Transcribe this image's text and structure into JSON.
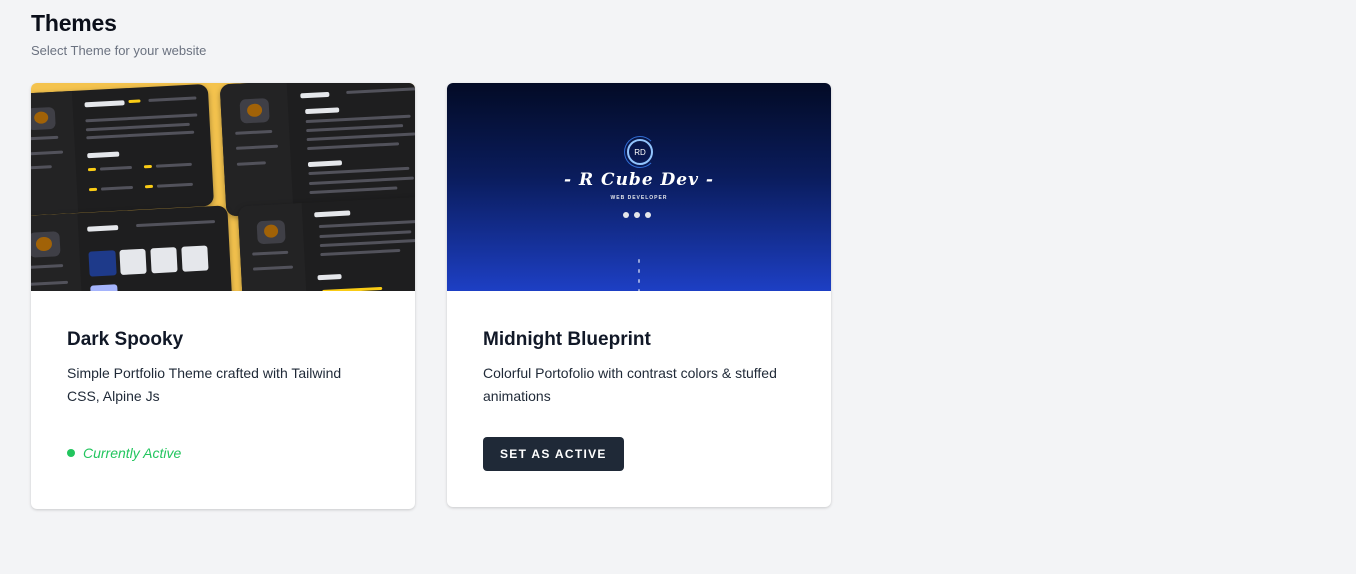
{
  "page": {
    "title": "Themes",
    "subtitle": "Select Theme for your website"
  },
  "themes": [
    {
      "name": "Dark Spooky",
      "description": "Simple Portfolio Theme crafted with Tailwind CSS, Alpine Js",
      "status": "Currently Active",
      "status_color": "#22c55e",
      "active": true
    },
    {
      "name": "Midnight Blueprint",
      "description": "Colorful Portofolio with contrast colors & stuffed animations",
      "action_label": "Set as active",
      "active": false
    }
  ],
  "previews": {
    "dark_spooky": {
      "accent": "#f4c34e"
    },
    "midnight_blueprint": {
      "logo": "RD",
      "brand": "- R Cube Dev -",
      "tagline": "WEB DEVELOPER",
      "gradient": [
        "#030b26",
        "#1d3fc4"
      ]
    }
  }
}
